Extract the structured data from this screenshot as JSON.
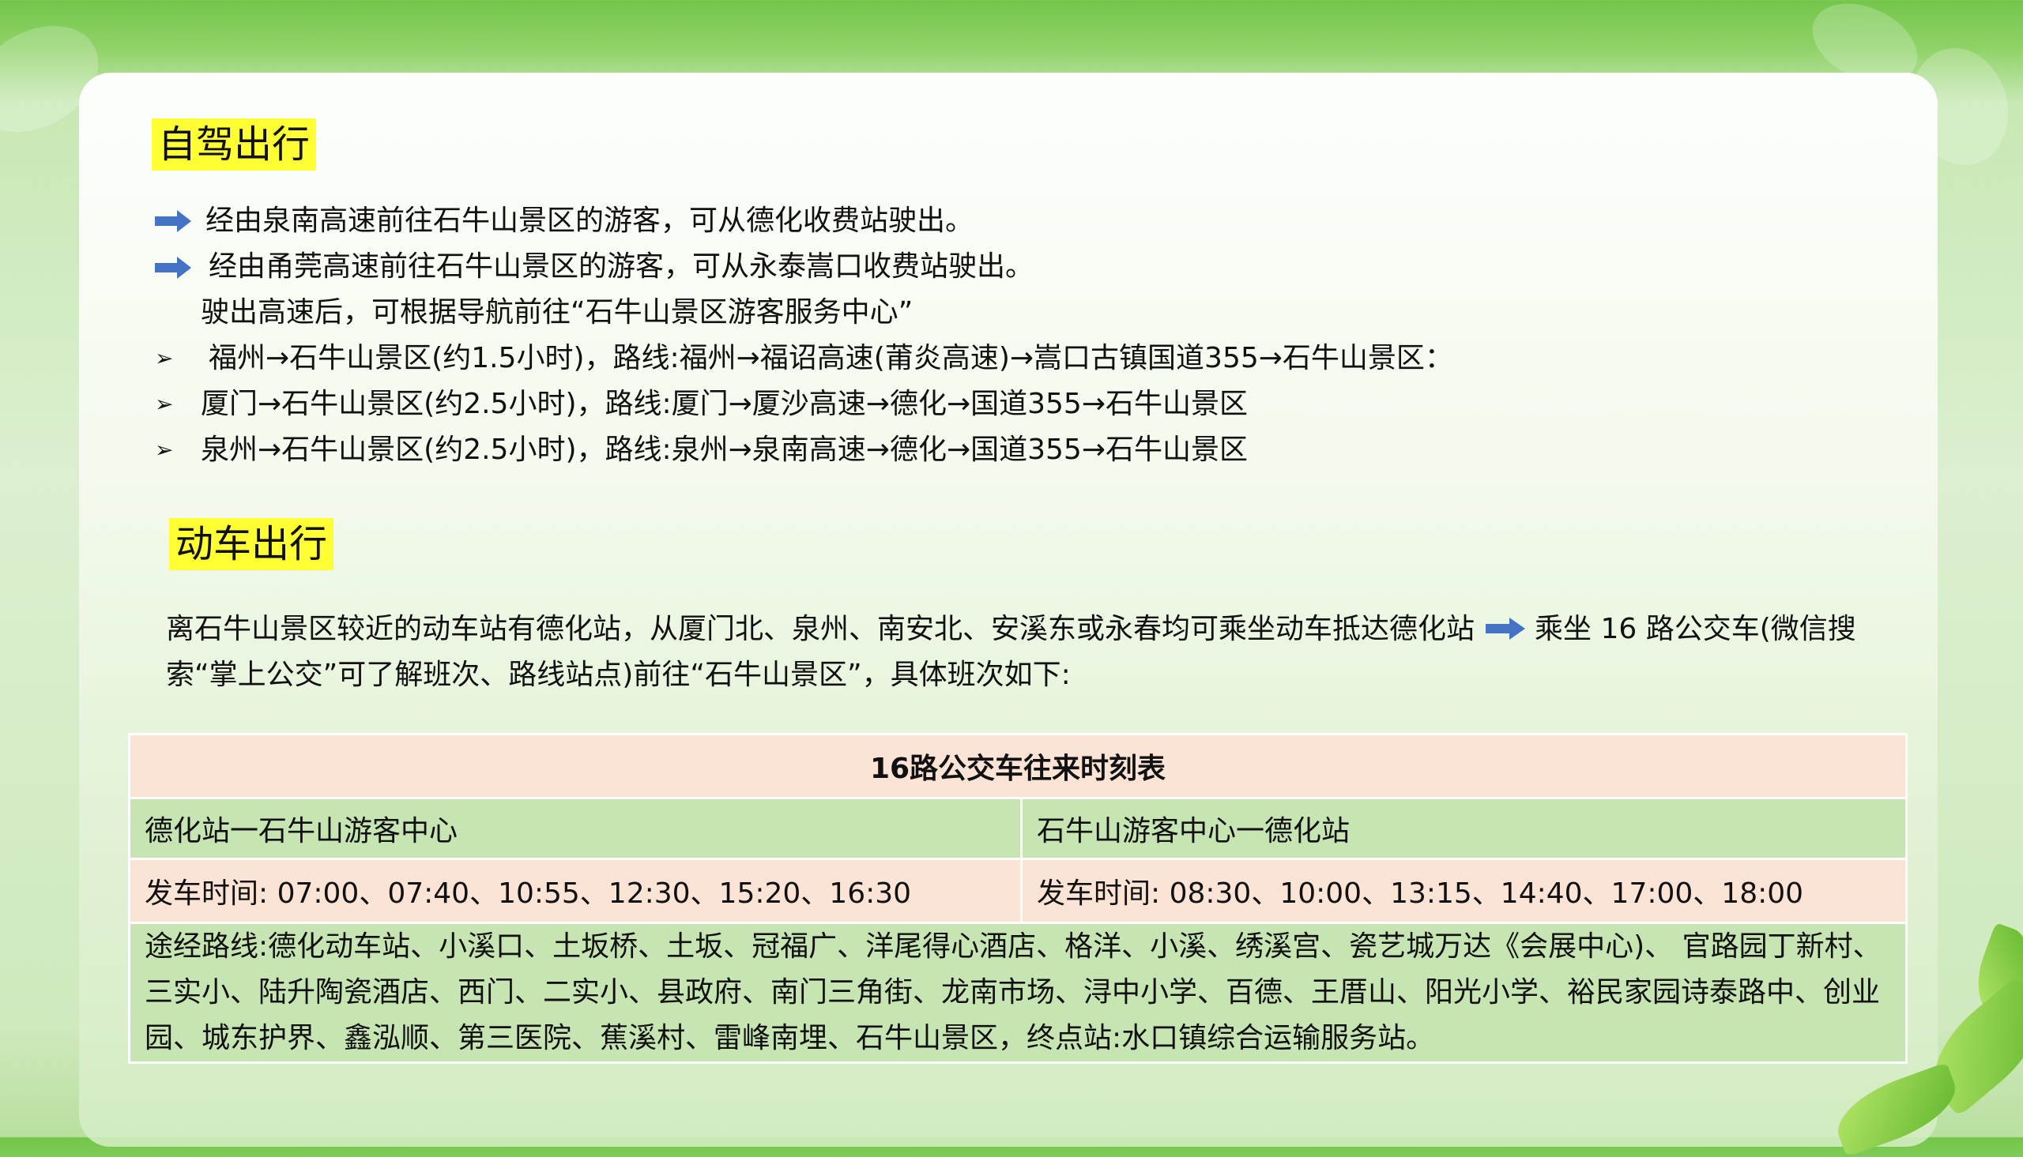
{
  "self_drive": {
    "heading": "自驾出行",
    "items": [
      "经由泉南高速前往石牛山景区的游客，可从德化收费站驶出。",
      "经由甬莞高速前往石牛山景区的游客，可从永泰嵩口收费站驶出。",
      "驶出高速后，可根据导航前往“石牛山景区游客服务中心”",
      "福州→石牛山景区(约1.5小时)，路线:福州→福诏高速(莆炎高速)→嵩口古镇国道355→石牛山景区：",
      "厦门→石牛山景区(约2.5小时)，路线:厦门→厦沙高速→德化→国道355→石牛山景区",
      "泉州→石牛山景区(约2.5小时)，路线:泉州→泉南高速→德化→国道355→石牛山景区"
    ]
  },
  "train": {
    "heading": "动车出行",
    "paragraph_part1": "离石牛山景区较近的动车站有德化站，从厦门北、泉州、南安北、安溪东或永春均可乘坐动车抵达德化站",
    "paragraph_part2": "乘坐 16 路公交车(微信搜索“掌上公交”可了解班次、路线站点)前往“石牛山景区”，具体班次如下:"
  },
  "timetable": {
    "title": "16路公交车往来时刻表",
    "direction_1": "德化站一石牛山游客中心",
    "direction_2": "石牛山游客中心一德化站",
    "times_1": "发车时间: 07:00、07:40、10:55、12:30、15:20、16:30",
    "times_2": "发车时间: 08:30、10:00、13:15、14:40、17:00、18:00",
    "route": "途经路线:德化动车站、小溪口、土坂桥、土坂、冠福广、洋尾得心酒店、格洋、小溪、绣溪宫、瓷艺城万达《会展中心)、 官路园丁新村、三实小、陆升陶瓷酒店、西门、二实小、县政府、南门三角街、龙南市场、浔中小学、百德、王厝山、阳光小学、裕民家园诗泰路中、创业园、城东护界、鑫泓顺、第三医院、蕉溪村、雷峰南埋、石牛山景区，终点站:水口镇综合运输服务站。"
  },
  "colors": {
    "highlight": "#ffff33",
    "arrow_blue": "#4472c4",
    "table_peach": "#fbe3d5",
    "table_green": "#c7e5b3"
  }
}
